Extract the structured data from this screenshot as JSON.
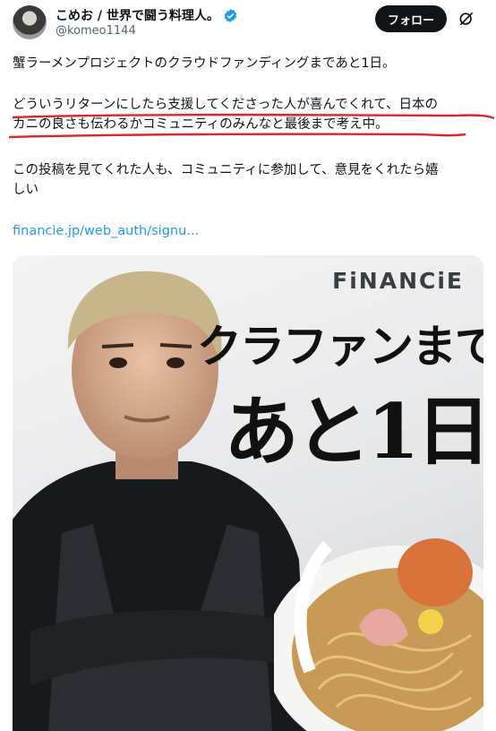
{
  "header": {
    "display_name": "こめお / 世界で闘う料理人。",
    "handle": "@komeo1144",
    "follow_label": "フォロー"
  },
  "tweet": {
    "line1": "蟹ラーメンプロジェクトのクラウドファンディングまであと1日。",
    "para2_line1": "どういうリターンにしたら支援してくださった人が喜んでくれて、日本の",
    "para2_line2": "カニの良さも伝わるかコミュニティのみんなと最後まで考え中。",
    "para3_line1": "この投稿を見てくれた人も、コミュニティに参加して、意見をくれたら嬉",
    "para3_line2": "しい",
    "link_text": "financie.jp/web_auth/signu..."
  },
  "media": {
    "brand": "FiNANCiE",
    "headline1": "クラファンまで",
    "headline2": "あと1日"
  },
  "icons": {
    "verified": "verified-badge-icon",
    "grok": "grok-icon"
  },
  "colors": {
    "link": "#1d9bf0",
    "underline": "#e0242b",
    "follow_bg": "#0f1419",
    "verified": "#1d9bf0"
  }
}
